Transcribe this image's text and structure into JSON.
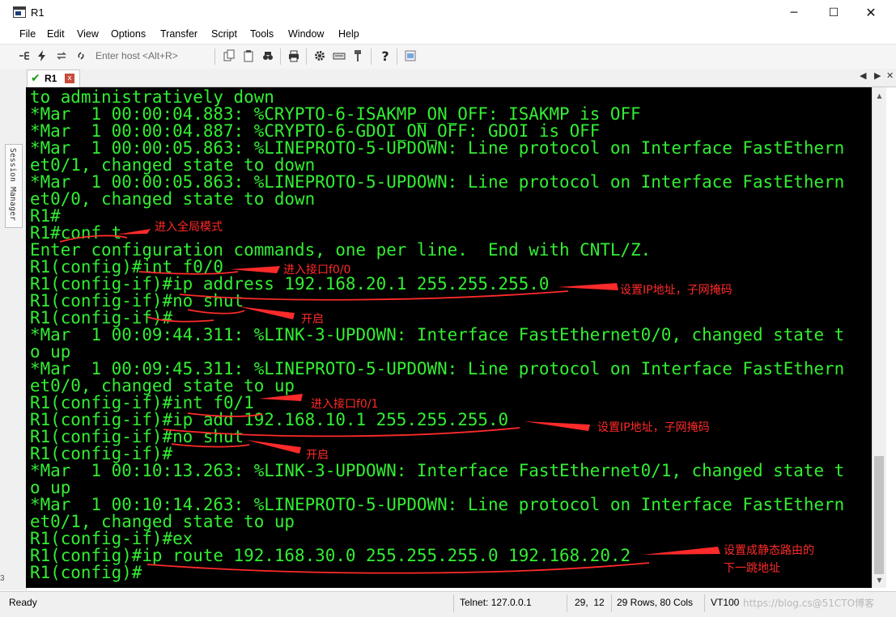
{
  "window": {
    "title": "R1",
    "controls": {
      "minimize": "─",
      "maximize": "☐",
      "close": "✕"
    }
  },
  "menu": [
    "File",
    "Edit",
    "View",
    "Options",
    "Transfer",
    "Script",
    "Tools",
    "Window",
    "Help"
  ],
  "toolbar": {
    "host_placeholder": "Enter host <Alt+R>",
    "icons": [
      "connect-icon",
      "lightning-icon",
      "reconnect-icon",
      "disconnect-icon",
      "copy-icon",
      "paste-icon",
      "find-icon",
      "print-icon",
      "settings-icon",
      "keymap-icon",
      "sftp-icon",
      "help-icon",
      "script-icon"
    ]
  },
  "session_manager": {
    "label": "Session Manager"
  },
  "tab": {
    "label": "R1",
    "status": "connected",
    "close": "x"
  },
  "terminal": {
    "color": "#33ee33",
    "lines": [
      "to administratively down",
      "*Mar  1 00:00:04.883: %CRYPTO-6-ISAKMP_ON_OFF: ISAKMP is OFF",
      "*Mar  1 00:00:04.887: %CRYPTO-6-GDOI_ON_OFF: GDOI is OFF",
      "*Mar  1 00:00:05.863: %LINEPROTO-5-UPDOWN: Line protocol on Interface FastEthern",
      "et0/1, changed state to down",
      "*Mar  1 00:00:05.863: %LINEPROTO-5-UPDOWN: Line protocol on Interface FastEthern",
      "et0/0, changed state to down",
      "R1#",
      "R1#conf t",
      "Enter configuration commands, one per line.  End with CNTL/Z.",
      "R1(config)#int f0/0",
      "R1(config-if)#ip address 192.168.20.1 255.255.255.0",
      "R1(config-if)#no shut",
      "R1(config-if)#",
      "*Mar  1 00:09:44.311: %LINK-3-UPDOWN: Interface FastEthernet0/0, changed state t",
      "o up",
      "*Mar  1 00:09:45.311: %LINEPROTO-5-UPDOWN: Line protocol on Interface FastEthern",
      "et0/0, changed state to up",
      "R1(config-if)#int f0/1",
      "R1(config-if)#ip add 192.168.10.1 255.255.255.0",
      "R1(config-if)#no shut",
      "R1(config-if)#",
      "*Mar  1 00:10:13.263: %LINK-3-UPDOWN: Interface FastEthernet0/1, changed state t",
      "o up",
      "*Mar  1 00:10:14.263: %LINEPROTO-5-UPDOWN: Line protocol on Interface FastEthern",
      "et0/1, changed state to up",
      "R1(config-if)#ex",
      "R1(config)#ip route 192.168.30.0 255.255.255.0 192.168.20.2",
      "R1(config)#"
    ]
  },
  "annotations": {
    "color": "#ff2a2a",
    "notes": [
      "进入全局模式",
      "进入接口f0/0",
      "设置IP地址，子网掩码",
      "开启",
      "进入接口f0/1",
      "设置IP地址，子网掩码",
      "开启",
      "设置成静态路由的",
      "下一跳地址"
    ]
  },
  "status": {
    "ready": "Ready",
    "telnet": "Telnet: 127.0.0.1",
    "cursor": "29,  12",
    "size": "29 Rows, 80 Cols",
    "emulation": "VT100",
    "watermark": "https://blog.cs@51CTO博客"
  },
  "edge_label": "3"
}
